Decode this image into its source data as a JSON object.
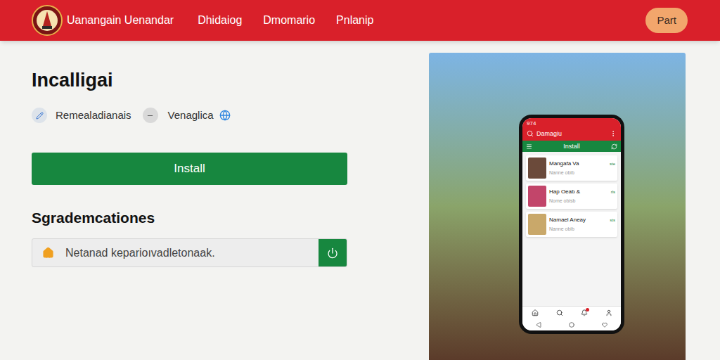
{
  "header": {
    "brand": "Uanangain Uenandar",
    "nav": [
      {
        "label": "Dhidaiog"
      },
      {
        "label": "Dmomario"
      },
      {
        "label": "Pnlanip"
      }
    ],
    "button": "Part"
  },
  "main": {
    "title": "Incalligai",
    "meta": [
      {
        "label": "Remealadianais"
      },
      {
        "label": "Venaglica"
      }
    ],
    "install_button": "Install",
    "section_title": "Sgrademcationes",
    "field": {
      "placeholder": "Netanad keparioıvadletonaak."
    }
  },
  "phone": {
    "time": "974",
    "title": "Damagiu",
    "tab": "Install",
    "items": [
      {
        "title": "Mangafa Va",
        "subtitle": "Nanne obib",
        "tag": "ste",
        "thumb": "#6b4a3a"
      },
      {
        "title": "Hap Oeab &",
        "subtitle": "Nome obisb",
        "tag": "rls",
        "thumb": "#c2456a"
      },
      {
        "title": "Namael Aneay",
        "subtitle": "Nanne obib",
        "tag": "sts",
        "thumb": "#c9a86a"
      }
    ]
  }
}
